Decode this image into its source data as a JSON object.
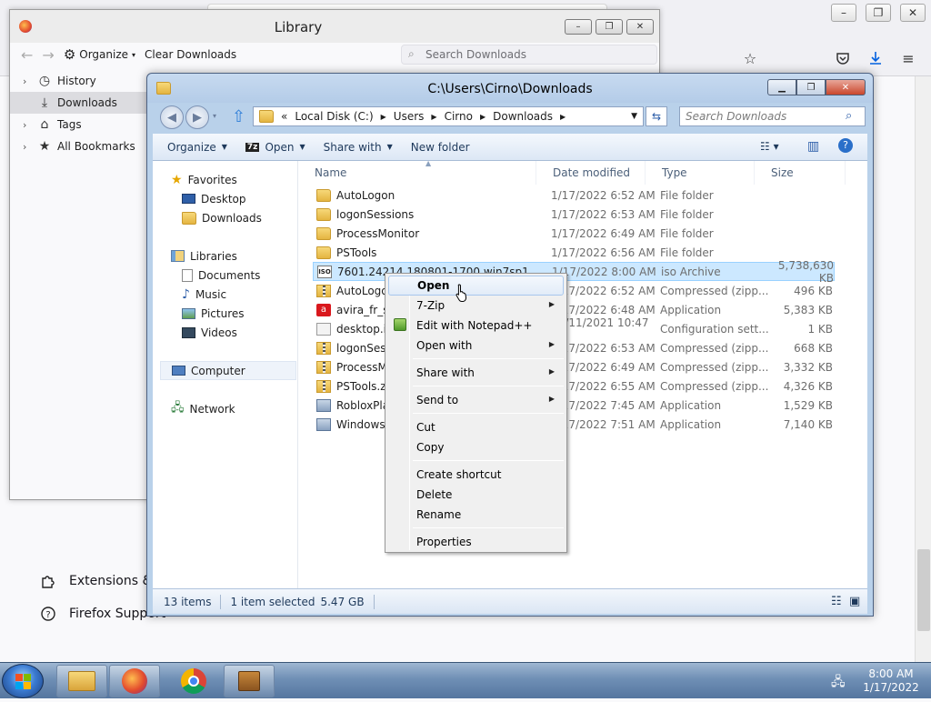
{
  "firefox": {
    "caption_buttons": [
      "–",
      "❐",
      "✕"
    ],
    "footer_items": [
      {
        "label": "Extensions & "
      },
      {
        "label": "Firefox Support"
      }
    ]
  },
  "library": {
    "title": "Library",
    "caption_buttons": [
      "–",
      "❐",
      "✕"
    ],
    "toolbar": {
      "organize_label": "Organize",
      "clear_downloads_label": "Clear Downloads"
    },
    "search_placeholder": "Search Downloads",
    "tree": [
      {
        "label": "History",
        "icon": "clock-icon",
        "expandable": true
      },
      {
        "label": "Downloads",
        "icon": "download-icon",
        "expandable": false,
        "selected": true
      },
      {
        "label": "Tags",
        "icon": "tag-icon",
        "expandable": true
      },
      {
        "label": "All Bookmarks",
        "icon": "star-icon",
        "expandable": true
      }
    ]
  },
  "explorer": {
    "title": "C:\\Users\\Cirno\\Downloads",
    "address": {
      "prefix": "«",
      "segments": [
        "Local Disk (C:)",
        "Users",
        "Cirno",
        "Downloads"
      ]
    },
    "search_placeholder": "Search Downloads",
    "commands": {
      "organize": "Organize",
      "open": "Open",
      "share_with": "Share with",
      "new_folder": "New folder"
    },
    "nav": {
      "favorites": "Favorites",
      "desktop": "Desktop",
      "downloads": "Downloads",
      "libraries": "Libraries",
      "documents": "Documents",
      "music": "Music",
      "pictures": "Pictures",
      "videos": "Videos",
      "computer": "Computer",
      "network": "Network"
    },
    "columns": {
      "name": "Name",
      "date": "Date modified",
      "type": "Type",
      "size": "Size"
    },
    "files": [
      {
        "name": "AutoLogon",
        "date": "1/17/2022 6:52 AM",
        "type": "File folder",
        "size": "",
        "icon": "folder"
      },
      {
        "name": "logonSessions",
        "date": "1/17/2022 6:53 AM",
        "type": "File folder",
        "size": "",
        "icon": "folder"
      },
      {
        "name": "ProcessMonitor",
        "date": "1/17/2022 6:49 AM",
        "type": "File folder",
        "size": "",
        "icon": "folder"
      },
      {
        "name": "PSTools",
        "date": "1/17/2022 6:56 AM",
        "type": "File folder",
        "size": "",
        "icon": "folder"
      },
      {
        "name": "7601.24214.180801-1700.win7sp1",
        "date": "1/17/2022 8:00 AM",
        "type": "iso Archive",
        "size": "5,738,630 KB",
        "icon": "iso",
        "selected": true
      },
      {
        "name": "AutoLogon",
        "date": "1/17/2022 6:52 AM",
        "type": "Compressed (zipp...",
        "size": "496 KB",
        "icon": "zip"
      },
      {
        "name": "avira_fr_sptl",
        "date": "1/17/2022 6:48 AM",
        "type": "Application",
        "size": "5,383 KB",
        "icon": "avira"
      },
      {
        "name": "desktop.ini",
        "date": "11/11/2021 10:47 ...",
        "type": "Configuration sett...",
        "size": "1 KB",
        "icon": "cfg"
      },
      {
        "name": "logonSessions",
        "date": "1/17/2022 6:53 AM",
        "type": "Compressed (zipp...",
        "size": "668 KB",
        "icon": "zip"
      },
      {
        "name": "ProcessMonitor",
        "date": "1/17/2022 6:49 AM",
        "type": "Compressed (zipp...",
        "size": "3,332 KB",
        "icon": "zip"
      },
      {
        "name": "PSTools.zip",
        "date": "1/17/2022 6:55 AM",
        "type": "Compressed (zipp...",
        "size": "4,326 KB",
        "icon": "zip"
      },
      {
        "name": "RobloxPlayer",
        "date": "1/17/2022 7:45 AM",
        "type": "Application",
        "size": "1,529 KB",
        "icon": "app"
      },
      {
        "name": "Windows-KB",
        "date": "1/17/2022 7:51 AM",
        "type": "Application",
        "size": "7,140 KB",
        "icon": "app"
      }
    ],
    "status": {
      "item_count": "13 items",
      "selected": "1 item selected",
      "selected_size": "5.47 GB"
    }
  },
  "context_menu": [
    {
      "label": "Open",
      "bold": true,
      "highlighted": true
    },
    {
      "label": "7-Zip",
      "submenu": true
    },
    {
      "label": "Edit with Notepad++",
      "icon": "notepad-icon"
    },
    {
      "label": "Open with",
      "submenu": true
    },
    {
      "separator": true
    },
    {
      "label": "Share with",
      "submenu": true
    },
    {
      "separator": true
    },
    {
      "label": "Send to",
      "submenu": true
    },
    {
      "separator": true
    },
    {
      "label": "Cut"
    },
    {
      "label": "Copy"
    },
    {
      "separator": true
    },
    {
      "label": "Create shortcut"
    },
    {
      "label": "Delete"
    },
    {
      "label": "Rename"
    },
    {
      "separator": true
    },
    {
      "label": "Properties"
    }
  ],
  "taskbar": {
    "apps": [
      "explorer",
      "firefox",
      "chrome",
      "toolbox"
    ],
    "clock_time": "8:00 AM",
    "clock_date": "1/17/2022"
  }
}
